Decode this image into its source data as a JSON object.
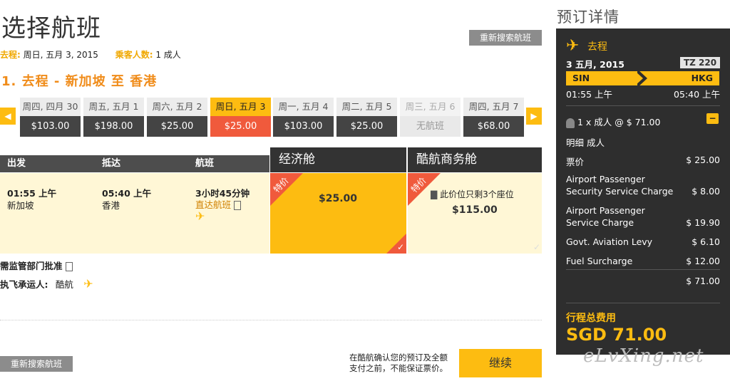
{
  "page": {
    "title": "选择航班",
    "research_label": "重新搜索航班"
  },
  "summary": {
    "leg_key": "去程:",
    "leg_value": "周日, 五月 3, 2015",
    "pax_key": "乘客人数:",
    "pax_value": "1 成人"
  },
  "leg": {
    "title": "1. 去程 - 新加坡 至 香港"
  },
  "date_strip": [
    {
      "day": "周四, 四月 30",
      "price": "$103.00"
    },
    {
      "day": "周五, 五月 1",
      "price": "$198.00"
    },
    {
      "day": "周六, 五月 2",
      "price": "$25.00"
    },
    {
      "day": "周日, 五月 3",
      "price": "$25.00"
    },
    {
      "day": "周一, 五月 4",
      "price": "$103.00"
    },
    {
      "day": "周二, 五月 5",
      "price": "$25.00"
    },
    {
      "day": "周三, 五月 6",
      "price": "无航班"
    },
    {
      "day": "周四, 五月 7",
      "price": "$68.00"
    }
  ],
  "table": {
    "headers": {
      "depart": "出发",
      "arrive": "抵达",
      "flight": "航班"
    },
    "cabins": {
      "economy": "经济舱",
      "business": "酷航商务舱"
    },
    "row": {
      "depart_time": "01:55 上午",
      "depart_city": "新加坡",
      "arrive_time": "05:40 上午",
      "arrive_city": "香港",
      "duration": "3小时45分钟",
      "direct_link": "直达航班"
    },
    "economy_fare": {
      "tag": "特价",
      "price": "$25.00"
    },
    "business_fare": {
      "tag": "特价",
      "seats_note": "此价位只剩3个座位",
      "price": "$115.00"
    }
  },
  "notes": {
    "approval": "需监管部门批准",
    "carrier_key": "执飞承运人:",
    "carrier_value": "酷航"
  },
  "footer": {
    "confirm_note_1": "在酷航确认您的预订及全额",
    "confirm_note_2": "支付之前，不能保证票价。",
    "continue_label": "继续"
  },
  "sidebar": {
    "title": "预订详情",
    "leg_label": "去程",
    "date": "3 五月, 2015",
    "flight_no": "TZ 220",
    "from_code": "SIN",
    "to_code": "HKG",
    "dep_time": "01:55 上午",
    "arr_time": "05:40 上午",
    "pax_line": "1 x 成人 @ $ 71.00",
    "detail_label": "明细 成人",
    "items": [
      {
        "label": "票价",
        "value": "$ 25.00"
      },
      {
        "label": "Airport Passenger",
        "label2": "Security Service Charge",
        "value": "$ 8.00"
      },
      {
        "label": "Airport Passenger",
        "label2": "Service Charge",
        "value": "$ 19.90"
      },
      {
        "label": "Govt. Aviation Levy",
        "value": "$ 6.10"
      },
      {
        "label": "Fuel Surcharge",
        "value": "$ 12.00"
      }
    ],
    "subtotal": "$ 71.00",
    "total_label": "行程总费用",
    "total_value": "SGD 71.00"
  },
  "watermark": "eLvXing.net",
  "colors": {
    "accent": "#fdbc11",
    "sale": "#f05a3c",
    "dark": "#2e2e2e"
  }
}
